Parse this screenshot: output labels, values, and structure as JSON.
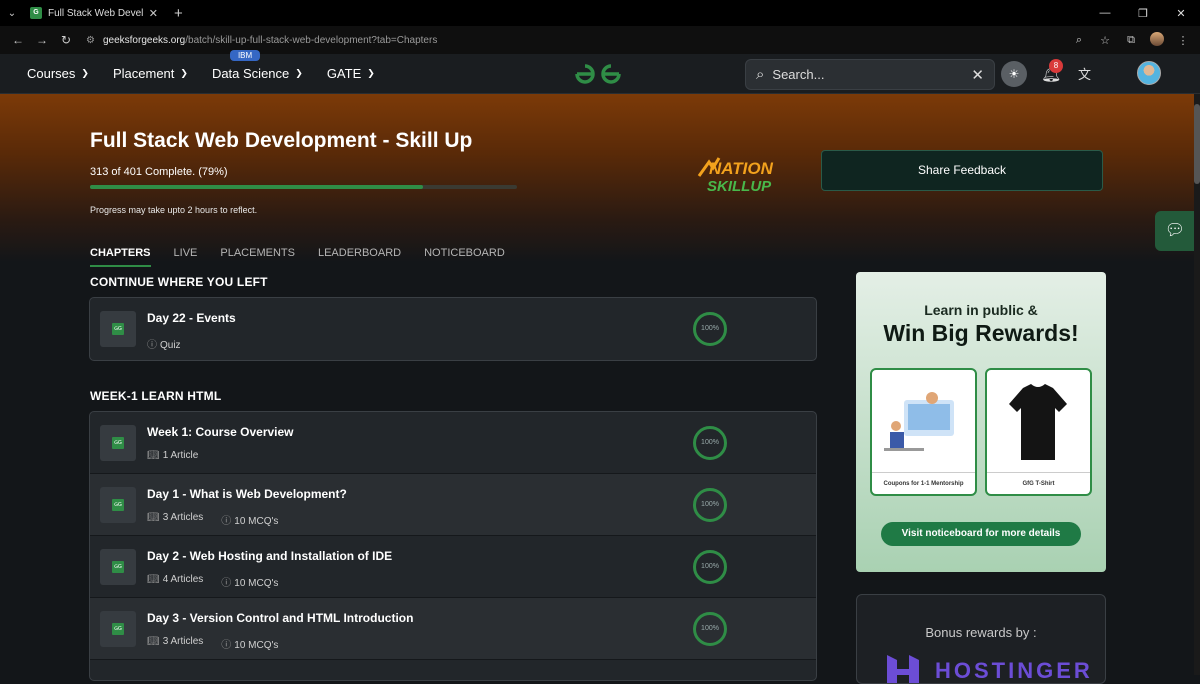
{
  "browser": {
    "tab_title": "Full Stack Web Development - Sk",
    "url_host": "geeksforgeeks.org",
    "url_path": "/batch/skill-up-full-stack-web-development?tab=Chapters"
  },
  "header": {
    "nav": [
      {
        "label": "Courses"
      },
      {
        "label": "Placement"
      },
      {
        "label": "Data Science",
        "badge": "IBM"
      },
      {
        "label": "GATE"
      }
    ],
    "search_placeholder": "Search...",
    "notification_count": "8"
  },
  "hero": {
    "title": "Full Stack Web Development - Skill Up",
    "progress_text": "313 of 401 Complete. (79%)",
    "progress_fraction": 0.78,
    "progress_note": "Progress may take upto 2 hours to reflect.",
    "logo_line1": "NATION",
    "logo_line2": "SKILLUP",
    "share_label": "Share Feedback"
  },
  "tabs": [
    "CHAPTERS",
    "LIVE",
    "PLACEMENTS",
    "LEADERBOARD",
    "NOTICEBOARD"
  ],
  "continue": {
    "title": "CONTINUE WHERE YOU LEFT",
    "item": {
      "title": "Day 22 - Events",
      "meta": "Quiz",
      "progress": "100%"
    }
  },
  "week1": {
    "title": "WEEK-1 LEARN HTML",
    "items": [
      {
        "title": "Week 1: Course Overview",
        "articles": "1 Article",
        "mcqs": "",
        "progress": "100%"
      },
      {
        "title": "Day 1 - What is Web Development?",
        "articles": "3 Articles",
        "mcqs": "10 MCQ's",
        "progress": "100%"
      },
      {
        "title": "Day 2 - Web Hosting and Installation of IDE",
        "articles": "4 Articles",
        "mcqs": "10 MCQ's",
        "progress": "100%"
      },
      {
        "title": "Day 3 - Version Control and HTML Introduction",
        "articles": "3 Articles",
        "mcqs": "10 MCQ's",
        "progress": "100%"
      }
    ]
  },
  "promo": {
    "line1": "Learn in public &",
    "line2": "Win Big Rewards!",
    "card1": "Coupons for 1-1 Mentorship",
    "card2": "GfG T-Shirt",
    "button": "Visit noticeboard for more details"
  },
  "bonus": {
    "title": "Bonus rewards by :",
    "brand": "HOSTINGER"
  },
  "colors": {
    "accent": "#2f8d46",
    "badge": "#d93a3a",
    "ibm": "#3567c4",
    "hostinger": "#6c4dd6"
  }
}
